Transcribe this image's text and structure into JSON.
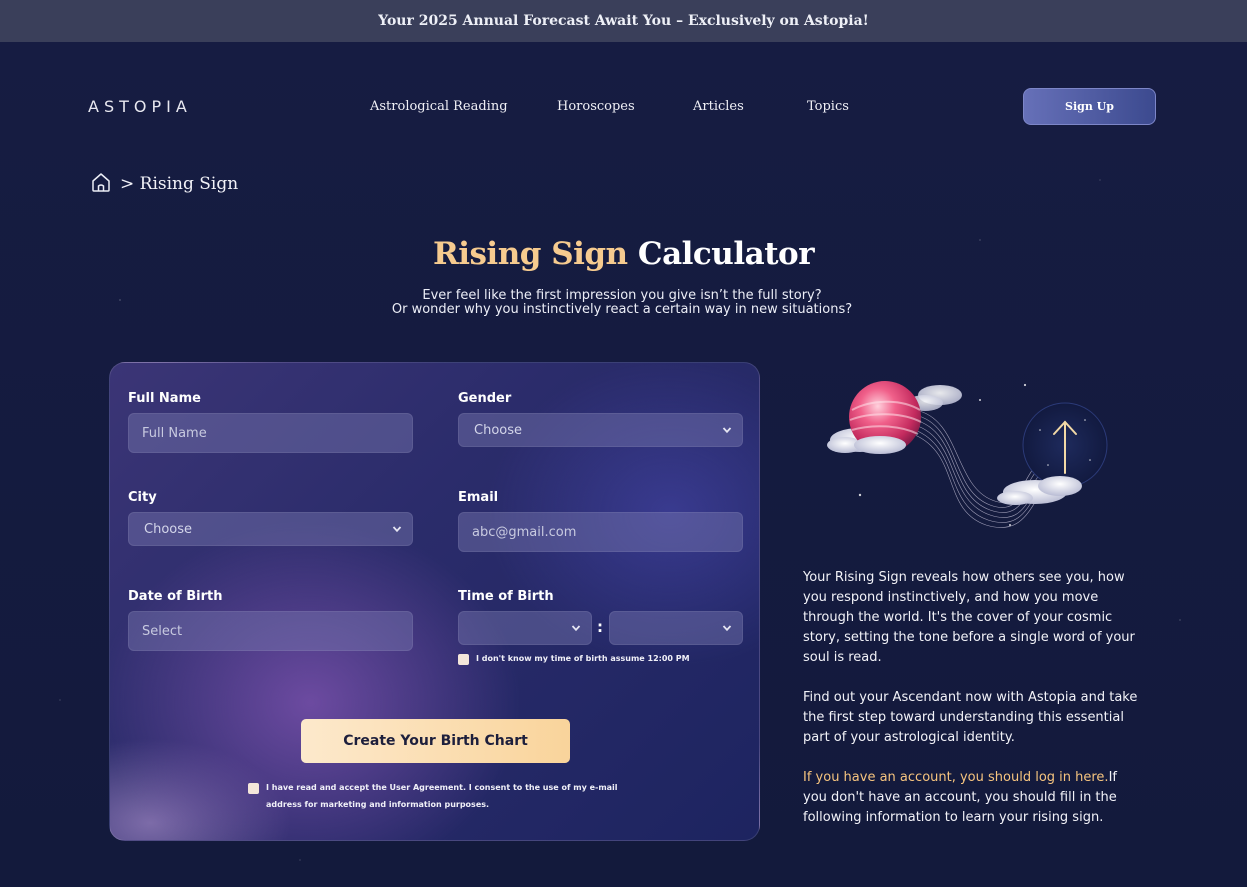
{
  "banner": {
    "text": "Your 2025 Annual Forecast Await You – Exclusively on Astopia!"
  },
  "header": {
    "logo": "ASTOPIA",
    "nav": [
      "Astrological Reading",
      "Horoscopes",
      "Articles",
      "Topics"
    ],
    "signup_label": "Sign Up"
  },
  "breadcrumb": {
    "current": "> Rising Sign"
  },
  "hero": {
    "title_gold": "Rising Sign",
    "title_white": "Calculator",
    "subtitle_line1": "Ever feel like the first impression you give isn’t the full story?",
    "subtitle_line2": "Or wonder why you instinctively react a certain way in new situations?"
  },
  "form": {
    "full_name": {
      "label": "Full Name",
      "placeholder": "Full Name"
    },
    "gender": {
      "label": "Gender",
      "value": "Choose"
    },
    "city": {
      "label": "City",
      "value": "Choose"
    },
    "email": {
      "label": "Email",
      "placeholder": "abc@gmail.com"
    },
    "dob": {
      "label": "Date of Birth",
      "placeholder": "Select"
    },
    "tob": {
      "label": "Time of Birth",
      "hour": "",
      "minute": "",
      "separator": ":"
    },
    "unknown_time_label": "I don't know my time of birth assume 12:00 PM",
    "submit_label": "Create Your Birth Chart",
    "agreement_line1": "I have read and accept the User Agreement. I consent to the use of my e-mail",
    "agreement_line2": "address for marketing and information purposes."
  },
  "info": {
    "para1": "Your Rising Sign reveals how others see you, how you respond instinctively, and how you move through the world. It's the cover of your cosmic story, setting the tone before a single word of your soul is read.",
    "para2": "Find out your Ascendant now with Astopia and take the first step toward understanding this essential part of your astrological identity.",
    "para3_link": "If you have an account, you should log in here.",
    "para3_rest": "If you don't have an account, you should fill in the following information to learn your rising sign."
  },
  "colors": {
    "accent_gold": "#f6cb8f",
    "background": "#141a3d",
    "button_gold": "#fde9cc"
  }
}
